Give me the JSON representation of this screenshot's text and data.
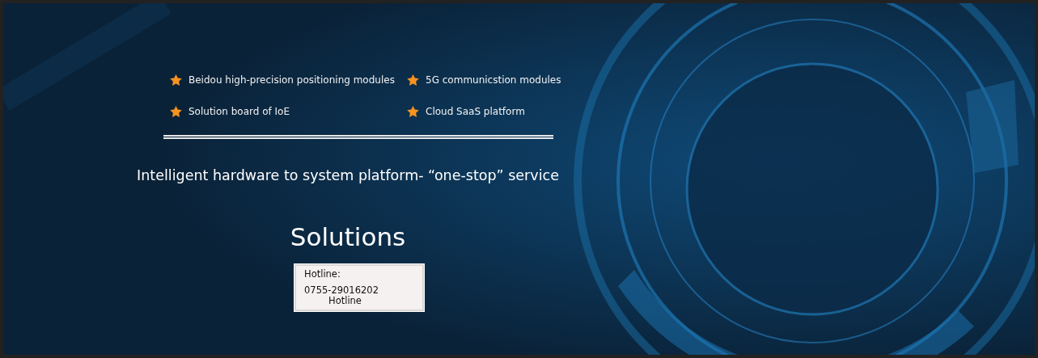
{
  "features": [
    {
      "label": "Beidou high-precision positioning modules"
    },
    {
      "label": "5G communicstion modules"
    },
    {
      "label": "Solution board of IoE"
    },
    {
      "label": "Cloud SaaS platform"
    }
  ],
  "tagline": "Intelligent hardware to system platform- “one-stop” service",
  "heading": "Solutions",
  "hotline": {
    "label": "Hotline:",
    "number": "0755-29016202",
    "caption": "Hotline"
  }
}
